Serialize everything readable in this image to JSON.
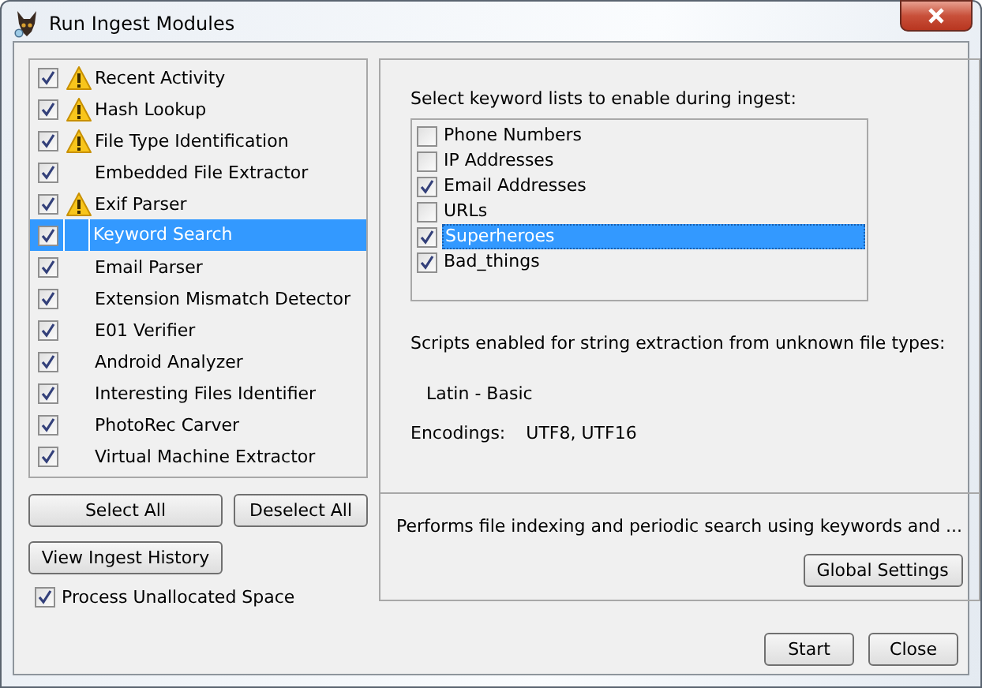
{
  "window": {
    "title": "Run Ingest Modules"
  },
  "modules": [
    {
      "name": "Recent Activity",
      "checked": true,
      "warning": true,
      "selected": false
    },
    {
      "name": "Hash Lookup",
      "checked": true,
      "warning": true,
      "selected": false
    },
    {
      "name": "File Type Identification",
      "checked": true,
      "warning": true,
      "selected": false
    },
    {
      "name": "Embedded File Extractor",
      "checked": true,
      "warning": false,
      "selected": false
    },
    {
      "name": "Exif Parser",
      "checked": true,
      "warning": true,
      "selected": false
    },
    {
      "name": "Keyword Search",
      "checked": true,
      "warning": false,
      "selected": true
    },
    {
      "name": "Email Parser",
      "checked": true,
      "warning": false,
      "selected": false
    },
    {
      "name": "Extension Mismatch Detector",
      "checked": true,
      "warning": false,
      "selected": false
    },
    {
      "name": "E01 Verifier",
      "checked": true,
      "warning": false,
      "selected": false
    },
    {
      "name": "Android Analyzer",
      "checked": true,
      "warning": false,
      "selected": false
    },
    {
      "name": "Interesting Files Identifier",
      "checked": true,
      "warning": false,
      "selected": false
    },
    {
      "name": "PhotoRec Carver",
      "checked": true,
      "warning": false,
      "selected": false
    },
    {
      "name": "Virtual Machine Extractor",
      "checked": true,
      "warning": false,
      "selected": false
    }
  ],
  "left_buttons": [
    "Select All",
    "Deselect All",
    "View Ingest History"
  ],
  "process_unallocated": {
    "label": "Process Unallocated Space",
    "checked": true
  },
  "settings": {
    "keyword_prompt": "Select keyword lists to enable during ingest:",
    "keyword_lists": [
      {
        "name": "Phone Numbers",
        "checked": false,
        "selected": false
      },
      {
        "name": "IP Addresses",
        "checked": false,
        "selected": false
      },
      {
        "name": "Email Addresses",
        "checked": true,
        "selected": false
      },
      {
        "name": "URLs",
        "checked": false,
        "selected": false
      },
      {
        "name": "Superheroes",
        "checked": true,
        "selected": true
      },
      {
        "name": "Bad_things",
        "checked": true,
        "selected": false
      }
    ],
    "scripts_label": "Scripts enabled for string extraction from unknown file types:",
    "scripts_value": "Latin - Basic",
    "encodings_label": "Encodings:",
    "encodings_value": "UTF8, UTF16"
  },
  "description": "Performs file indexing and periodic search using keywords and ...",
  "global_settings_button": "Global Settings",
  "footer_buttons": [
    "Start",
    "Close"
  ]
}
